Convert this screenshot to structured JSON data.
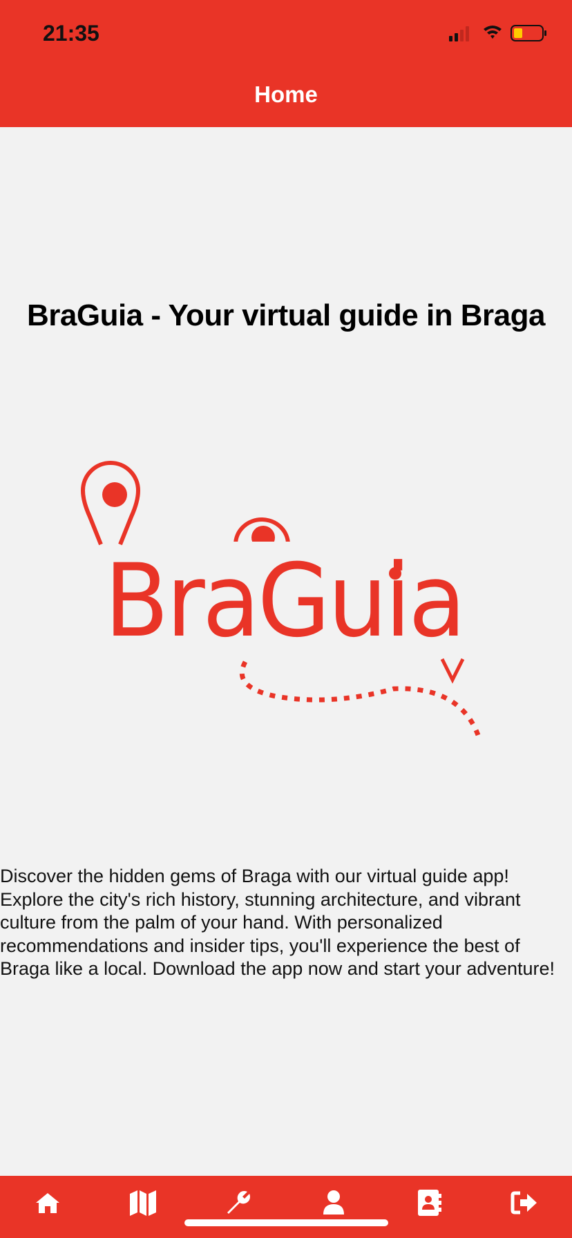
{
  "status_bar": {
    "time": "21:35",
    "icons": [
      "signal-icon",
      "wifi-icon",
      "battery-icon"
    ]
  },
  "header": {
    "title": "Home"
  },
  "main": {
    "headline": "BraGuia - Your virtual guide in Braga",
    "logo_text": "BraGuia",
    "description": "Discover the hidden gems of Braga with our virtual guide app! Explore the city's rich history, stunning architecture, and vibrant culture from the palm of your hand. With personalized recommendations and insider tips, you'll experience the best of Braga like a local. Download the app now and start your adventure!"
  },
  "tab_bar": {
    "items": [
      {
        "icon": "home-icon"
      },
      {
        "icon": "map-icon"
      },
      {
        "icon": "wrench-icon"
      },
      {
        "icon": "user-icon"
      },
      {
        "icon": "contacts-icon"
      },
      {
        "icon": "logout-icon"
      }
    ]
  },
  "colors": {
    "brand": "#e93427",
    "background": "#f2f2f2"
  }
}
